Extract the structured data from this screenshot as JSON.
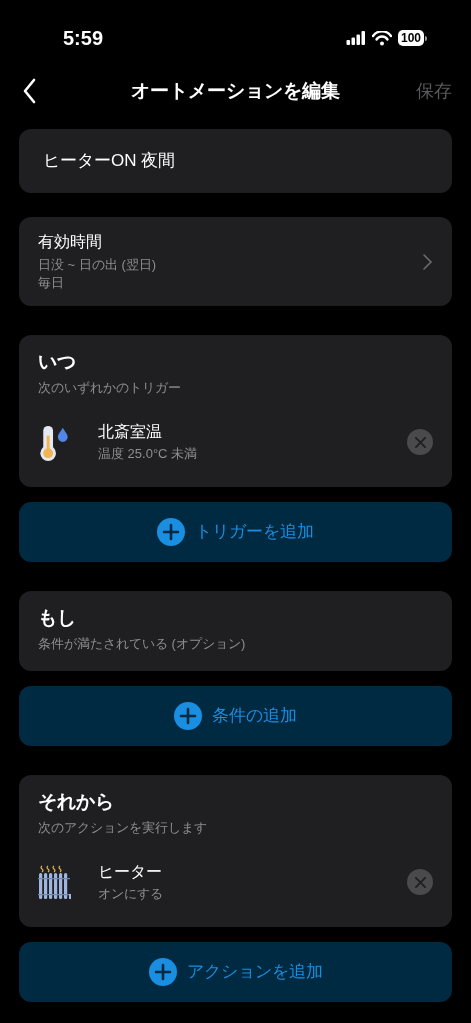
{
  "status_bar": {
    "time": "5:59",
    "battery": "100"
  },
  "nav": {
    "title": "オートメーションを編集",
    "save": "保存",
    "save_disabled": true
  },
  "name_field": {
    "value": "ヒーターON 夜間"
  },
  "valid_time": {
    "title": "有効時間",
    "range": "日没 ~ 日の出 (翌日)",
    "repeat": "毎日"
  },
  "sections": [
    {
      "title": "いつ",
      "subtitle": "次のいずれかのトリガー",
      "items": [
        {
          "kind": "thermometer",
          "name": "北斎室温",
          "detail": "温度 25.0°C 未満"
        }
      ],
      "add_button": "トリガーを追加"
    },
    {
      "title": "もし",
      "subtitle": "条件が満たされている (オプション)",
      "add_button": "条件の追加"
    },
    {
      "title": "それから",
      "subtitle": "次のアクションを実行します",
      "items": [
        {
          "kind": "heater",
          "name": "ヒーター",
          "detail": "オンにする"
        }
      ],
      "add_button": "アクションを追加"
    }
  ]
}
